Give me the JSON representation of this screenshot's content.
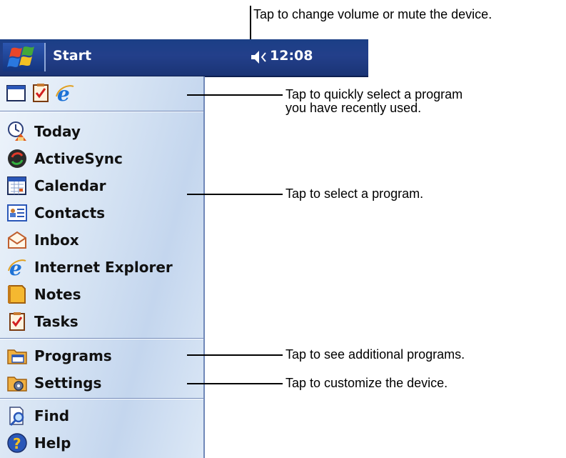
{
  "taskbar": {
    "start_label": "Start",
    "clock": "12:08",
    "volume_icon": "speaker-muted-icon"
  },
  "recent_programs": [
    {
      "icon": "calendar-window-icon"
    },
    {
      "icon": "tasks-checkbox-icon"
    },
    {
      "icon": "internet-explorer-icon"
    }
  ],
  "programs": [
    {
      "label": "Today",
      "icon": "today-icon"
    },
    {
      "label": "ActiveSync",
      "icon": "activesync-icon"
    },
    {
      "label": "Calendar",
      "icon": "calendar-icon"
    },
    {
      "label": "Contacts",
      "icon": "contacts-icon"
    },
    {
      "label": "Inbox",
      "icon": "inbox-icon"
    },
    {
      "label": "Internet Explorer",
      "icon": "internet-explorer-icon"
    },
    {
      "label": "Notes",
      "icon": "notes-icon"
    },
    {
      "label": "Tasks",
      "icon": "tasks-icon"
    }
  ],
  "more": [
    {
      "label": "Programs",
      "icon": "programs-folder-icon"
    },
    {
      "label": "Settings",
      "icon": "settings-folder-icon"
    }
  ],
  "utility": [
    {
      "label": "Find",
      "icon": "find-icon"
    },
    {
      "label": "Help",
      "icon": "help-icon"
    }
  ],
  "callouts": {
    "volume": "Tap to change volume or mute the device.",
    "recent_line1": "Tap to quickly select a program",
    "recent_line2": "you have recently used.",
    "select": "Tap to select a program.",
    "programs": "Tap to see additional programs.",
    "settings": "Tap to customize the device."
  },
  "colors": {
    "taskbar": "#233f8a",
    "menu_background": "#d8e5f4",
    "separator": "#6f87b8"
  }
}
